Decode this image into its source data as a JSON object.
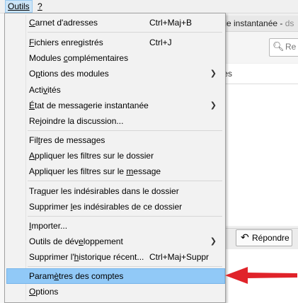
{
  "menubar": {
    "outils": "Outils",
    "help": "?"
  },
  "background": {
    "title_visible": "gerie instantanée - ",
    "title_dim": "ds",
    "search_placeholder": "Re",
    "column_fragment": "tes",
    "reply_label": "Répondre"
  },
  "menu": {
    "items": [
      {
        "pre": "",
        "u": "C",
        "post": "arnet d'adresses",
        "accel": "Ctrl+Maj+B",
        "submenu": false
      },
      {
        "pre": "",
        "u": "F",
        "post": "ichiers enregistrés",
        "accel": "Ctrl+J",
        "submenu": false
      },
      {
        "pre": "Modules ",
        "u": "c",
        "post": "omplémentaires",
        "accel": "",
        "submenu": false
      },
      {
        "pre": "O",
        "u": "p",
        "post": "tions des modules",
        "accel": "",
        "submenu": true
      },
      {
        "pre": "Acti",
        "u": "v",
        "post": "ités",
        "accel": "",
        "submenu": false
      },
      {
        "pre": "",
        "u": "É",
        "post": "tat de messagerie instantanée",
        "accel": "",
        "submenu": true
      },
      {
        "pre": "Re",
        "u": "j",
        "post": "oindre la discussion...",
        "accel": "",
        "submenu": false
      },
      {
        "pre": "Fil",
        "u": "t",
        "post": "res de messages",
        "accel": "",
        "submenu": false
      },
      {
        "pre": "",
        "u": "A",
        "post": "ppliquer les filtres sur le dossier",
        "accel": "",
        "submenu": false
      },
      {
        "pre": "Appliquer les filtres sur le ",
        "u": "m",
        "post": "essage",
        "accel": "",
        "submenu": false
      },
      {
        "pre": "Tra",
        "u": "q",
        "post": "uer les indésirables dans le dossier",
        "accel": "",
        "submenu": false
      },
      {
        "pre": "Supprimer ",
        "u": "l",
        "post": "es indésirables de ce dossier",
        "accel": "",
        "submenu": false
      },
      {
        "pre": "",
        "u": "I",
        "post": "mporter...",
        "accel": "",
        "submenu": false
      },
      {
        "pre": "Outils de dév",
        "u": "e",
        "post": "loppement",
        "accel": "",
        "submenu": true
      },
      {
        "pre": "Supprimer l'",
        "u": "h",
        "post": "istorique récent...",
        "accel": "Ctrl+Maj+Suppr",
        "submenu": false
      },
      {
        "pre": "Param",
        "u": "è",
        "post": "tres des comptes",
        "accel": "",
        "submenu": false
      },
      {
        "pre": "",
        "u": "O",
        "post": "ptions",
        "accel": "",
        "submenu": false
      }
    ],
    "highlight_color": "#91c9f7"
  },
  "annotation": {
    "color": "#e0232a",
    "icon": "left-arrow-icon"
  }
}
